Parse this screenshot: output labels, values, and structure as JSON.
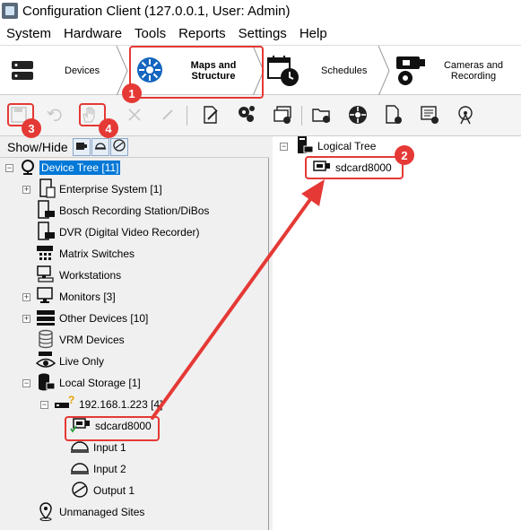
{
  "window": {
    "title": "Configuration Client (127.0.0.1, User: Admin)"
  },
  "menu": [
    "System",
    "Hardware",
    "Tools",
    "Reports",
    "Settings",
    "Help"
  ],
  "nav": {
    "devices": "Devices",
    "maps_line1": "Maps and",
    "maps_line2": "Structure",
    "schedules": "Schedules",
    "cameras_line1": "Cameras and",
    "cameras_line2": "Recording"
  },
  "left": {
    "show_hide_label": "Show/Hide"
  },
  "tree": {
    "root": "Device Tree [11]",
    "enterprise": "Enterprise System [1]",
    "bosch": "Bosch Recording Station/DiBos",
    "dvr": "DVR (Digital Video Recorder)",
    "matrix": "Matrix Switches",
    "workstations": "Workstations",
    "monitors": "Monitors [3]",
    "other": "Other Devices [10]",
    "vrm": "VRM Devices",
    "live": "Live Only",
    "local": "Local Storage [1]",
    "ip": "192.168.1.223 [4]",
    "sdcard": "sdcard8000",
    "input1": "Input 1",
    "input2": "Input 2",
    "output1": "Output 1",
    "unmanaged": "Unmanaged Sites"
  },
  "logical": {
    "root": "Logical Tree",
    "sdcard": "sdcard8000"
  },
  "annotations": {
    "b1": "1",
    "b2": "2",
    "b3": "3",
    "b4": "4"
  },
  "colors": {
    "annotation": "#e53935",
    "selection": "#0078d7",
    "active_tab_icon": "#1565c0"
  }
}
